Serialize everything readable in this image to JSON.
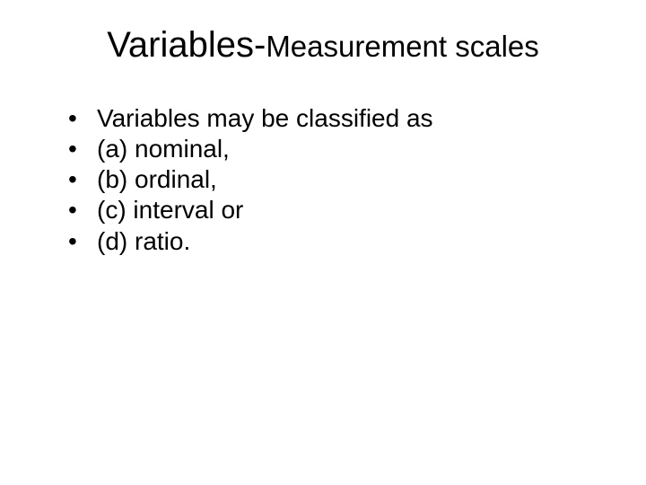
{
  "title": {
    "main": "Variables-",
    "sub": "Measurement scales"
  },
  "bullets": [
    "Variables may be classified as",
    "(a) nominal,",
    "(b) ordinal,",
    "(c) interval or",
    "(d) ratio."
  ]
}
